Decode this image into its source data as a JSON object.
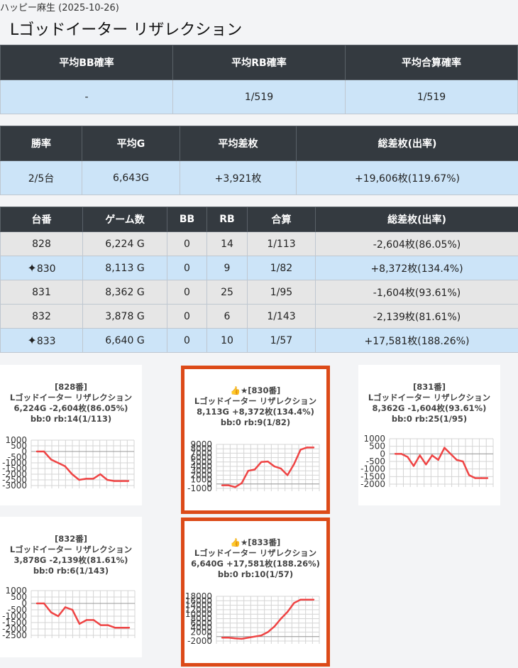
{
  "header": {
    "subtitle": "ハッピー麻生 (2025-10-26)",
    "title": "Lゴッドイーター リザレクション"
  },
  "summary1": {
    "headers": [
      "平均BB確率",
      "平均RB確率",
      "平均合算確率"
    ],
    "values": [
      "-",
      "1/519",
      "1/519"
    ]
  },
  "summary2": {
    "headers": [
      "勝率",
      "平均G",
      "平均差枚",
      "総差枚(出率)"
    ],
    "values": [
      "2/5台",
      "6,643G",
      "+3,921枚",
      "+19,606枚(119.67%)"
    ]
  },
  "machines": {
    "headers": [
      "台番",
      "ゲーム数",
      "BB",
      "RB",
      "合算",
      "総差枚(出率)"
    ],
    "rows": [
      {
        "id": "828",
        "games": "6,224 G",
        "bb": "0",
        "rb": "14",
        "total": "1/113",
        "diff": "-2,604枚(86.05%)",
        "highlight": false
      },
      {
        "id": "830",
        "games": "8,113 G",
        "bb": "0",
        "rb": "9",
        "total": "1/82",
        "diff": "+8,372枚(134.4%)",
        "highlight": true
      },
      {
        "id": "831",
        "games": "8,362 G",
        "bb": "0",
        "rb": "25",
        "total": "1/95",
        "diff": "-1,604枚(93.61%)",
        "highlight": false
      },
      {
        "id": "832",
        "games": "3,878 G",
        "bb": "0",
        "rb": "6",
        "total": "1/143",
        "diff": "-2,139枚(81.61%)",
        "highlight": false
      },
      {
        "id": "833",
        "games": "6,640 G",
        "bb": "0",
        "rb": "10",
        "total": "1/57",
        "diff": "+17,581枚(188.26%)",
        "highlight": true
      }
    ],
    "highlight_icon": "sparkle-icon",
    "highlight_glyph": "✦"
  },
  "cards": [
    {
      "line1": "[828番]",
      "line2": "Lゴッドイーター リザレクション",
      "line3": "6,224G -2,604枚(86.05%)",
      "line4": "bb:0 rb:14(1/113)",
      "highlight": false
    },
    {
      "line1": "👍★[830番]",
      "line2": "Lゴッドイーター リザレクション",
      "line3": "8,113G +8,372枚(134.4%)",
      "line4": "bb:0 rb:9(1/82)",
      "highlight": true
    },
    {
      "line1": "[831番]",
      "line2": "Lゴッドイーター リザレクション",
      "line3": "8,362G -1,604枚(93.61%)",
      "line4": "bb:0 rb:25(1/95)",
      "highlight": false
    },
    {
      "line1": "[832番]",
      "line2": "Lゴッドイーター リザレクション",
      "line3": "3,878G -2,139枚(81.61%)",
      "line4": "bb:0 rb:6(1/143)",
      "highlight": false
    },
    {
      "line1": "👍★[833番]",
      "line2": "Lゴッドイーター リザレクション",
      "line3": "6,640G +17,581枚(188.26%)",
      "line4": "bb:0 rb:10(1/57)",
      "highlight": true
    }
  ],
  "chart_data": [
    {
      "type": "line",
      "machine": "828",
      "yticks": [
        1000,
        500,
        0,
        -500,
        -1000,
        -1500,
        -2000,
        -2500,
        -3000
      ],
      "ylim": [
        -3000,
        1000
      ],
      "values": [
        0,
        0,
        -700,
        -1000,
        -1300,
        -2000,
        -2500,
        -2400,
        -2400,
        -2000,
        -2500,
        -2600,
        -2600,
        -2600
      ],
      "line_color": "#ef4444"
    },
    {
      "type": "line",
      "machine": "830",
      "yticks": [
        9000,
        8000,
        7000,
        6000,
        5000,
        4000,
        3000,
        2000,
        1000,
        0,
        -1000
      ],
      "ylim": [
        -1000,
        9000
      ],
      "values": [
        -300,
        -300,
        -700,
        200,
        3000,
        3300,
        5000,
        5100,
        4000,
        3500,
        2000,
        4500,
        7800,
        8300,
        8300
      ],
      "line_color": "#ef4444"
    },
    {
      "type": "line",
      "machine": "831",
      "yticks": [
        1000,
        500,
        0,
        -500,
        -1000,
        -1500,
        -2000
      ],
      "ylim": [
        -2000,
        1000
      ],
      "values": [
        0,
        0,
        -200,
        -800,
        -100,
        -700,
        -100,
        -400,
        400,
        0,
        -400,
        -500,
        -1400,
        -1600,
        -1600,
        -1600
      ],
      "line_color": "#ef4444"
    },
    {
      "type": "line",
      "machine": "832",
      "yticks": [
        1000,
        500,
        0,
        -500,
        -1000,
        -1500,
        -2000,
        -2500
      ],
      "ylim": [
        -2500,
        1000
      ],
      "values": [
        0,
        0,
        -700,
        -1000,
        -300,
        -500,
        -1600,
        -1300,
        -1300,
        -1700,
        -1700,
        -1900,
        -1900,
        -1900
      ],
      "line_color": "#ef4444"
    },
    {
      "type": "line",
      "machine": "833",
      "yticks": [
        18000,
        16000,
        14000,
        12000,
        10000,
        8000,
        6000,
        4000,
        2000,
        0,
        -2000
      ],
      "ylim": [
        -2000,
        18000
      ],
      "values": [
        -500,
        -500,
        -800,
        -1000,
        -500,
        0,
        500,
        2000,
        4500,
        8000,
        11000,
        15000,
        16500,
        16500,
        16500
      ],
      "line_color": "#ef4444"
    }
  ]
}
